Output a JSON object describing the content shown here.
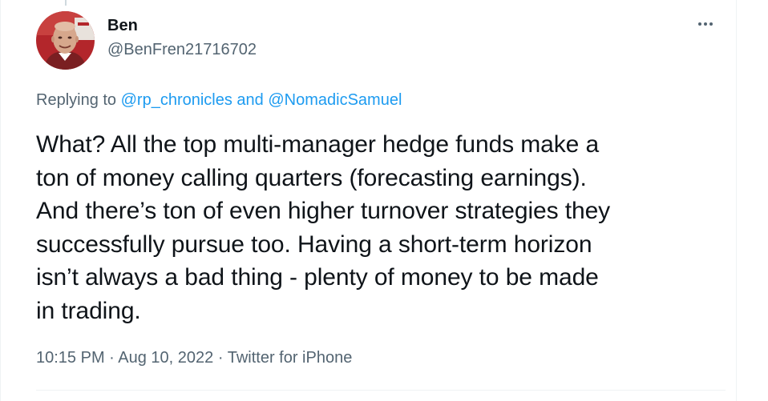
{
  "author": {
    "name": "Ben",
    "handle": "@BenFren21716702"
  },
  "reply": {
    "prefix": "Replying to ",
    "mention1": "@rp_chronicles",
    "conjunction": " and ",
    "mention2": "@NomadicSamuel"
  },
  "tweet": {
    "text": "What? All the top multi-manager hedge funds make a\nton of money calling quarters (forecasting earnings).\nAnd there’s ton of even higher turnover strategies they\nsuccessfully pursue too. Having a short-term horizon\nisn’t always a bad thing - plenty of money to be made\nin trading."
  },
  "meta": {
    "time": "10:15 PM",
    "sep1": " · ",
    "date": "Aug 10, 2022",
    "sep2": " · ",
    "source": "Twitter for iPhone"
  },
  "icons": {
    "more": "more-horizontal-icon",
    "avatar": "profile-photo"
  },
  "colors": {
    "text": "#0f1419",
    "secondary": "#536471",
    "link": "#1d9bf0",
    "border": "#eff3f4"
  }
}
